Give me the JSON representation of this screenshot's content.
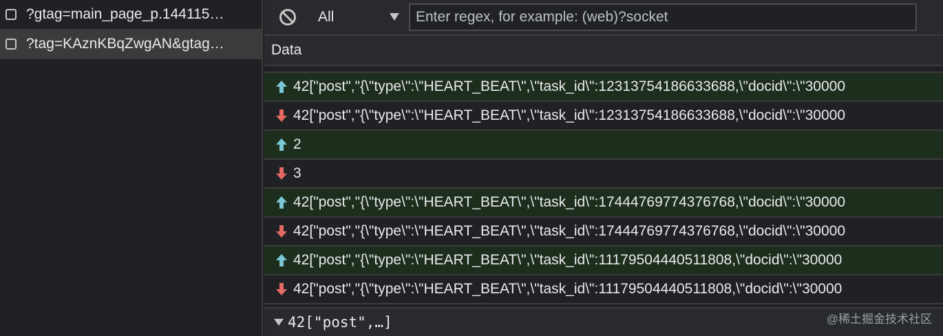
{
  "requests": [
    {
      "name": "?gtag=main_page_p.144115…",
      "selected": false
    },
    {
      "name": "?tag=KAznKBqZwgAN&gtag…",
      "selected": true
    }
  ],
  "toolbar": {
    "filter_value": "All",
    "regex_placeholder": "Enter regex, for example: (web)?socket"
  },
  "table": {
    "column_header": "Data",
    "frames": [
      {
        "direction": "sent",
        "text": "42[\"post\",\"{\\\"type\\\":\\\"HEART_BEAT\\\",\\\"task_id\\\":12313754186633688,\\\"docid\\\":\\\"30000"
      },
      {
        "direction": "received",
        "text": "42[\"post\",\"{\\\"type\\\":\\\"HEART_BEAT\\\",\\\"task_id\\\":12313754186633688,\\\"docid\\\":\\\"30000"
      },
      {
        "direction": "sent",
        "text": "2"
      },
      {
        "direction": "received",
        "text": "3"
      },
      {
        "direction": "sent",
        "text": "42[\"post\",\"{\\\"type\\\":\\\"HEART_BEAT\\\",\\\"task_id\\\":17444769774376768,\\\"docid\\\":\\\"30000"
      },
      {
        "direction": "received",
        "text": "42[\"post\",\"{\\\"type\\\":\\\"HEART_BEAT\\\",\\\"task_id\\\":17444769774376768,\\\"docid\\\":\\\"30000"
      },
      {
        "direction": "sent",
        "text": "42[\"post\",\"{\\\"type\\\":\\\"HEART_BEAT\\\",\\\"task_id\\\":11179504440511808,\\\"docid\\\":\\\"30000"
      },
      {
        "direction": "received",
        "text": "42[\"post\",\"{\\\"type\\\":\\\"HEART_BEAT\\\",\\\"task_id\\\":11179504440511808,\\\"docid\\\":\\\"30000"
      }
    ]
  },
  "detail": {
    "preview": "42[\"post\",…]"
  },
  "watermark": "@稀土掘金技术社区",
  "colors": {
    "sent_arrow": "#7cc7d6",
    "received_arrow": "#e46962",
    "sent_row_bg": "#1e2e1c"
  }
}
